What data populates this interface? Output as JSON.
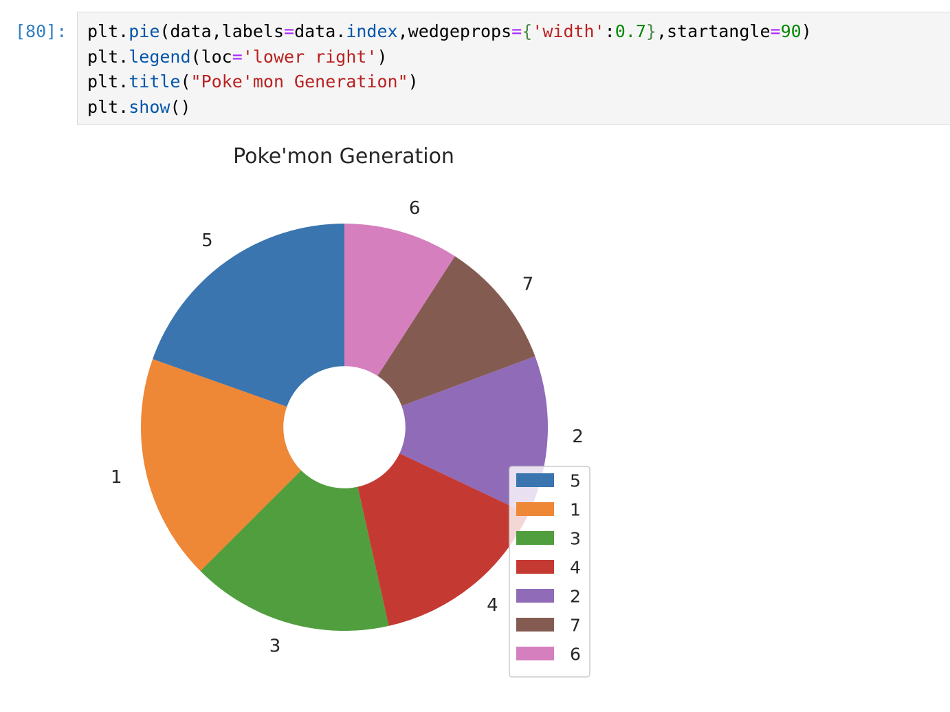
{
  "cell": {
    "prompt": "[80]:",
    "code_lines": [
      [
        {
          "t": "plt."
        },
        {
          "t": "pie",
          "c": "fn"
        },
        {
          "t": "(data,labels"
        },
        {
          "t": "=",
          "c": "op"
        },
        {
          "t": "data."
        },
        {
          "t": "index",
          "c": "fn"
        },
        {
          "t": ",wedgeprops"
        },
        {
          "t": "=",
          "c": "op"
        },
        {
          "t": "{",
          "c": "brace"
        },
        {
          "t": "'width'",
          "c": "str"
        },
        {
          "t": ":"
        },
        {
          "t": "0.7",
          "c": "num"
        },
        {
          "t": "}",
          "c": "brace"
        },
        {
          "t": ",startangle"
        },
        {
          "t": "=",
          "c": "op"
        },
        {
          "t": "90",
          "c": "num"
        },
        {
          "t": ")"
        }
      ],
      [
        {
          "t": "plt."
        },
        {
          "t": "legend",
          "c": "fn"
        },
        {
          "t": "(loc"
        },
        {
          "t": "=",
          "c": "op"
        },
        {
          "t": "'lower right'",
          "c": "str"
        },
        {
          "t": ")"
        }
      ],
      [
        {
          "t": "plt."
        },
        {
          "t": "title",
          "c": "fn"
        },
        {
          "t": "("
        },
        {
          "t": "\"Poke'mon Generation\"",
          "c": "str"
        },
        {
          "t": ")"
        }
      ],
      [
        {
          "t": "plt."
        },
        {
          "t": "show",
          "c": "fn"
        },
        {
          "t": "()"
        }
      ]
    ]
  },
  "colors": {
    "fn": "#0055aa",
    "op": "#aa22ff",
    "str": "#ba2121",
    "num": "#008800",
    "brace": "#4a8a4a"
  },
  "chart_data": {
    "type": "pie",
    "title": "Poke'mon Generation",
    "categories": [
      "5",
      "1",
      "3",
      "4",
      "2",
      "7",
      "6"
    ],
    "values": [
      165,
      151,
      135,
      122,
      107,
      86,
      77
    ],
    "colors": [
      "#3a75af",
      "#ee8736",
      "#519e3e",
      "#c43a32",
      "#8f6bb8",
      "#845b51",
      "#d57fbe"
    ],
    "startangle": 90,
    "counterclock": true,
    "wedge_width": 0.7,
    "legend": {
      "loc": "lower right",
      "entries": [
        "5",
        "1",
        "3",
        "4",
        "2",
        "7",
        "6"
      ]
    }
  }
}
